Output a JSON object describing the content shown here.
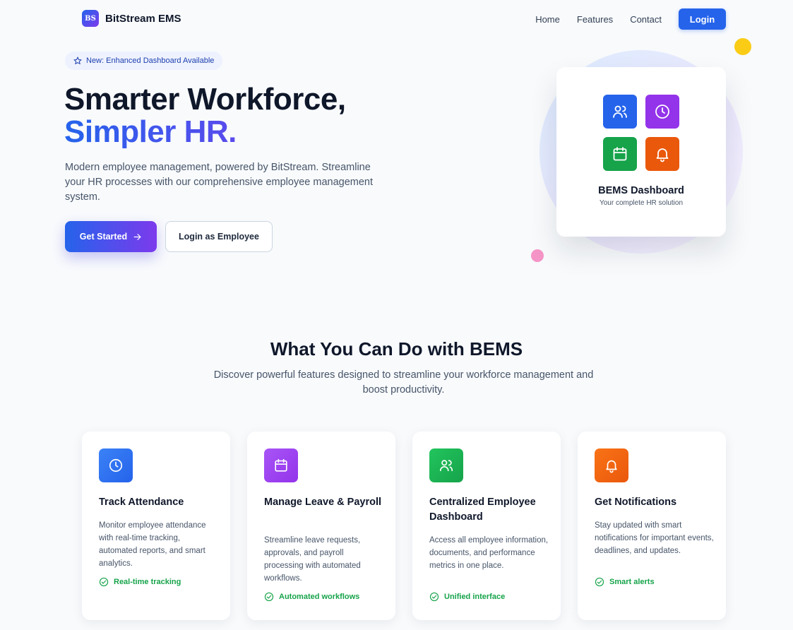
{
  "brand": {
    "logo_text": "BS",
    "name": "BitStream EMS"
  },
  "nav": {
    "links": [
      "Home",
      "Features",
      "Contact"
    ],
    "login_label": "Login"
  },
  "hero": {
    "badge": "New: Enhanced Dashboard Available",
    "title_line1": "Smarter Workforce,",
    "title_line2": "Simpler HR.",
    "subtitle": "Modern employee management, powered by BitStream. Streamline your HR processes with our comprehensive employee management system.",
    "primary_button": "Get Started",
    "secondary_button": "Login as Employee"
  },
  "dashboard_card": {
    "title": "BEMS Dashboard",
    "subtitle": "Your complete HR solution",
    "tiles": [
      "users-icon",
      "clock-icon",
      "calendar-icon",
      "bell-icon"
    ]
  },
  "features": {
    "title": "What You Can Do with BEMS",
    "subtitle": "Discover powerful features designed to streamline your workforce management and boost productivity.",
    "cards": [
      {
        "icon": "clock-icon",
        "title": "Track Attendance",
        "description": "Monitor employee attendance with real-time tracking, automated reports, and smart analytics.",
        "tag": "Real-time tracking"
      },
      {
        "icon": "calendar-icon",
        "title": "Manage Leave & Payroll",
        "description": "Streamline leave requests, approvals, and payroll processing with automated workflows.",
        "tag": "Automated workflows"
      },
      {
        "icon": "users-icon",
        "title": "Centralized Employee Dashboard",
        "description": "Access all employee information, documents, and performance metrics in one place.",
        "tag": "Unified interface"
      },
      {
        "icon": "bell-icon",
        "title": "Get Notifications",
        "description": "Stay updated with smart notifications for important events, deadlines, and updates.",
        "tag": "Smart alerts"
      }
    ]
  },
  "colors": {
    "primary": "#2563eb",
    "accent": "#7c3aed",
    "success": "#16a34a",
    "warning": "#ea580c"
  }
}
